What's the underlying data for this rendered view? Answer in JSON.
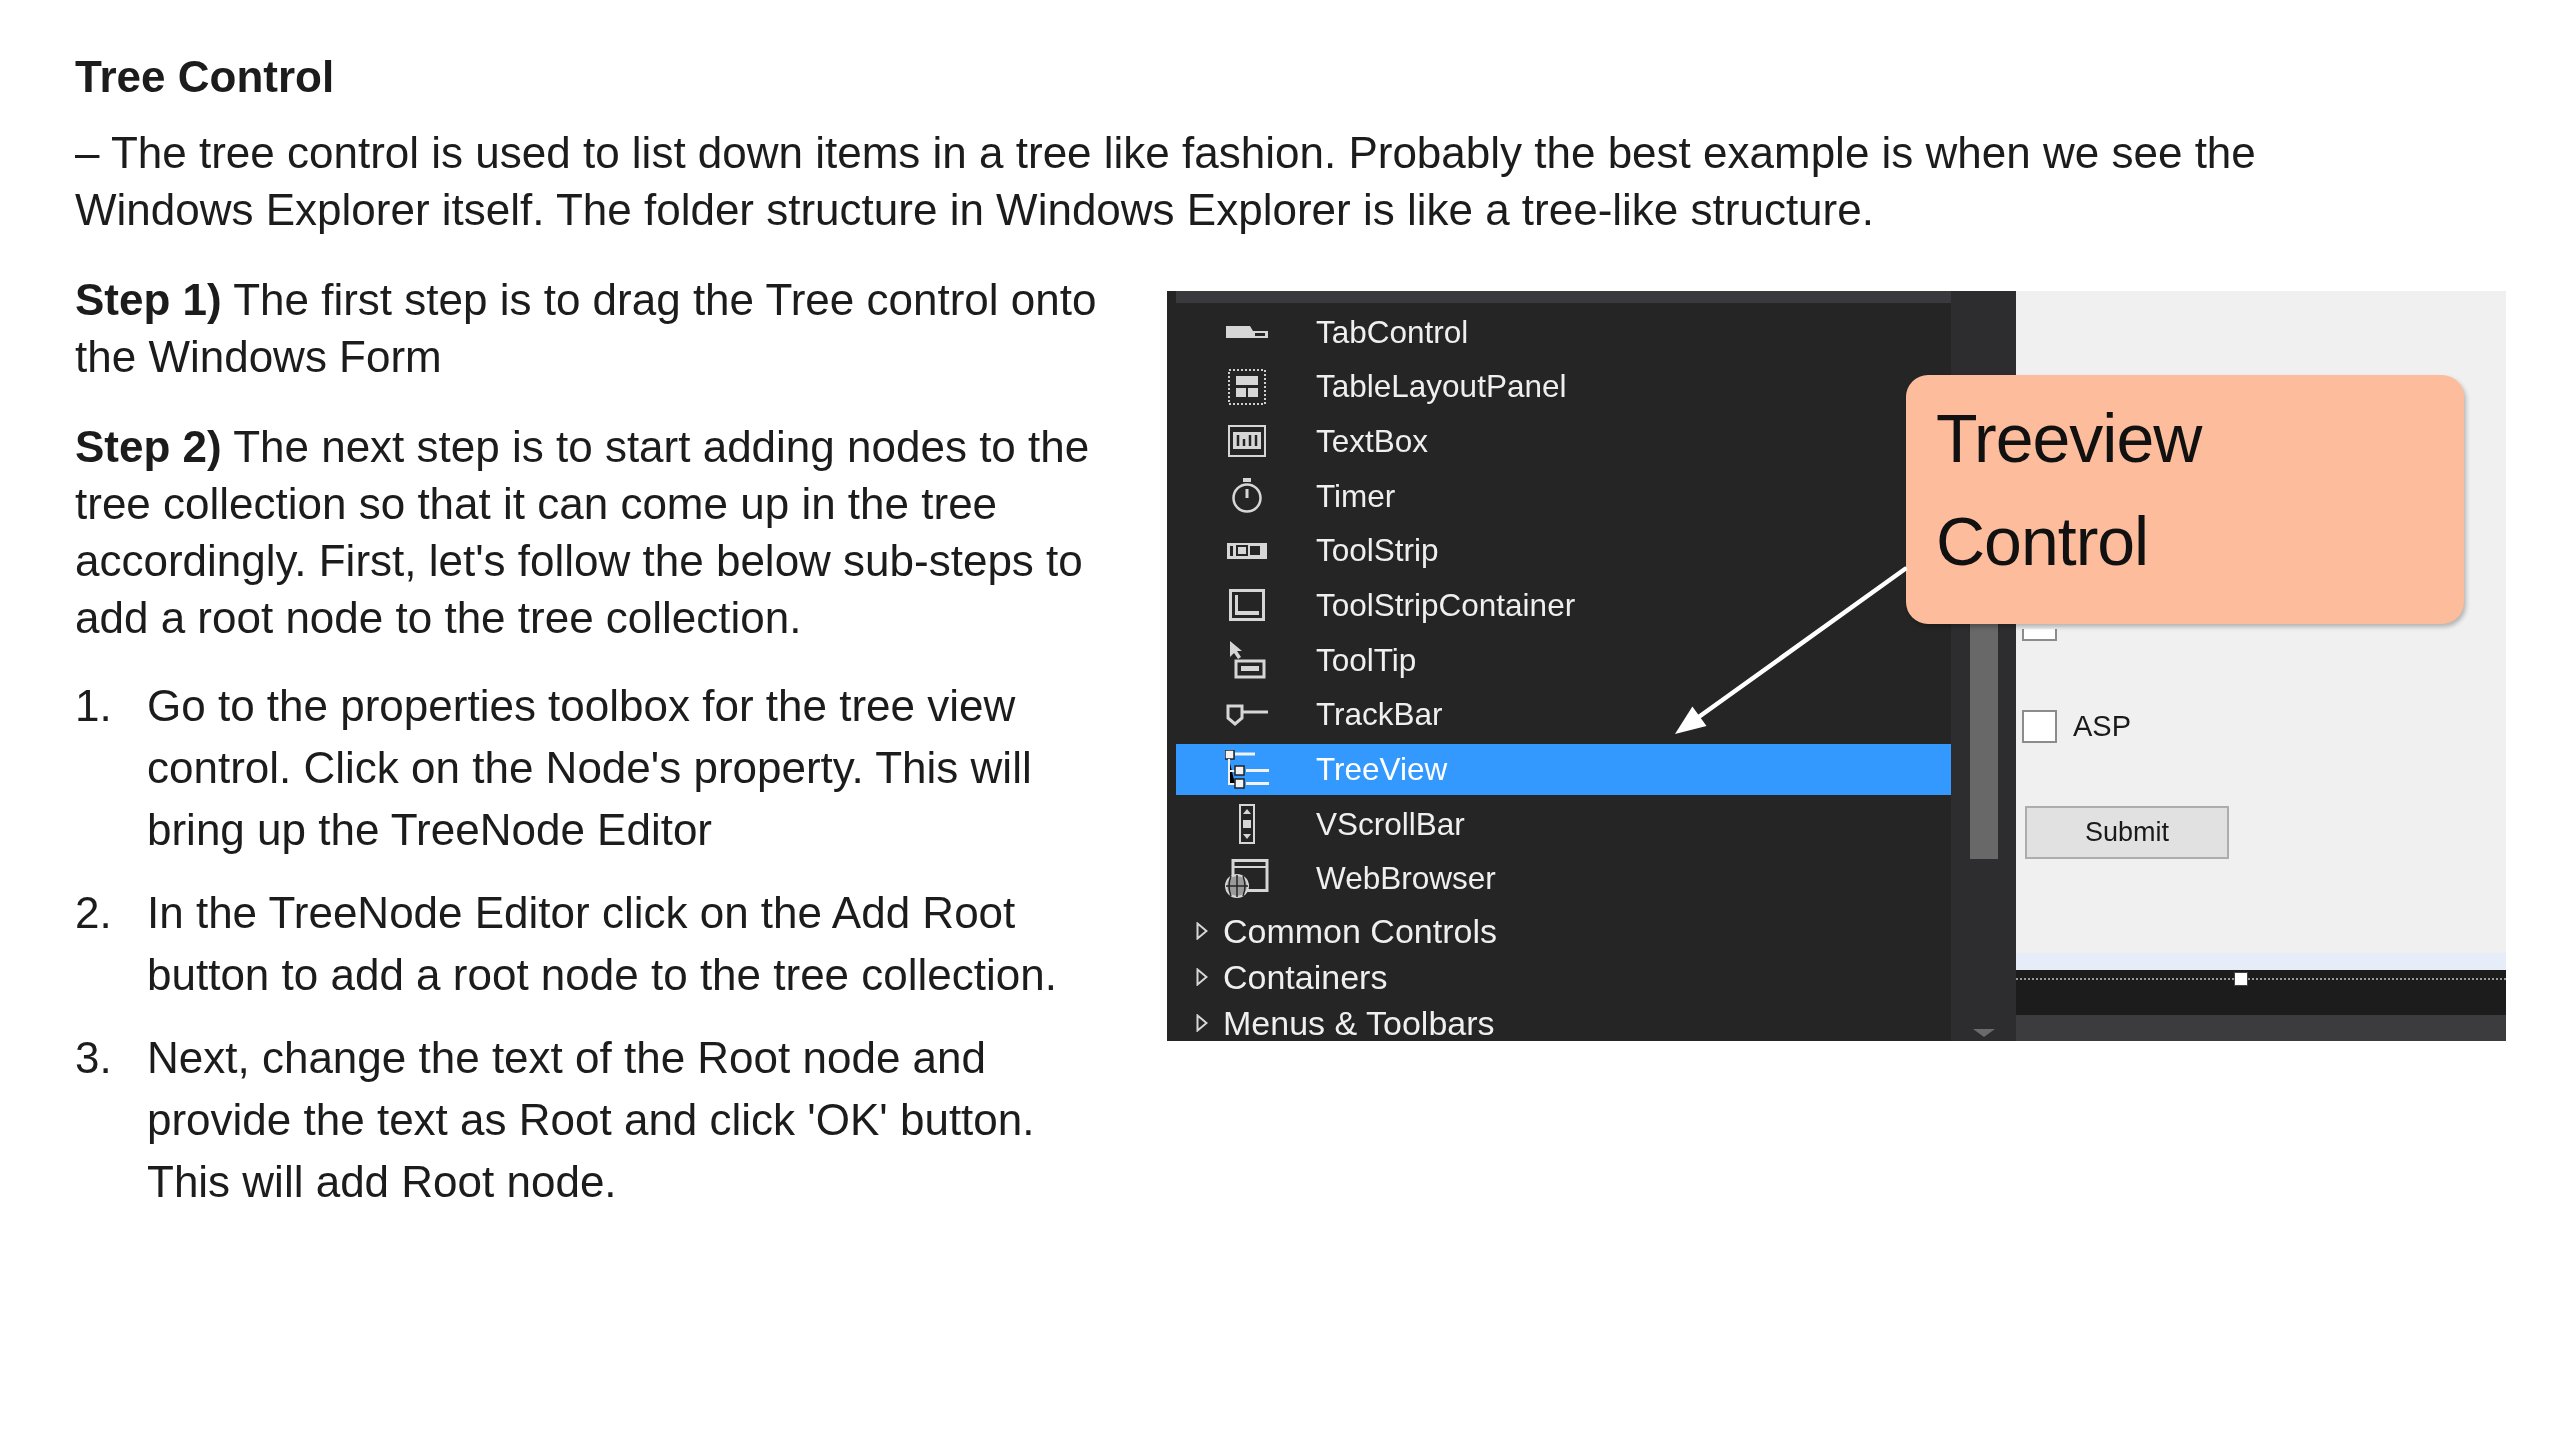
{
  "heading": "Tree Control",
  "intro": "– The tree control is used to list down items in a tree like fashion. Probably the best example is when we see the Windows Explorer itself. The folder structure in Windows Explorer is like a tree-like structure.",
  "steps": [
    "**Step 1)** The first step is to drag the Tree control onto the Windows Form",
    "**Step 2)** The next step is to start adding nodes to the tree collection so that it can come up in the tree accordingly. First, let's follow the below sub-steps to add a root node to the tree collection."
  ],
  "substeps": [
    {
      "number": "1.",
      "text": "Go to the properties toolbox for the tree view control. Click on the Node's property. This will bring up the TreeNode Editor"
    },
    {
      "number": "2.",
      "text": "In the TreeNode Editor click on the Add Root button to add a root node to the tree collection."
    },
    {
      "number": "3.",
      "text": "Next, change the text of the Root node and provide the text as Root and click 'OK' button. This will add Root node."
    }
  ],
  "screenshot": {
    "toolbox": {
      "items": [
        {
          "label": "TabControl",
          "selected": false
        },
        {
          "label": "TableLayoutPanel",
          "selected": false
        },
        {
          "label": "TextBox",
          "selected": false
        },
        {
          "label": "Timer",
          "selected": false
        },
        {
          "label": "ToolStrip",
          "selected": false
        },
        {
          "label": "ToolStripContainer",
          "selected": false
        },
        {
          "label": "ToolTip",
          "selected": false
        },
        {
          "label": "TrackBar",
          "selected": false
        },
        {
          "label": "TreeView",
          "selected": true
        },
        {
          "label": "VScrollBar",
          "selected": false
        },
        {
          "label": "WebBrowser",
          "selected": false
        }
      ],
      "categories": [
        {
          "label": "Common Controls",
          "expanded": false
        },
        {
          "label": "Containers",
          "expanded": false
        },
        {
          "label": "Menus & Toolbars",
          "expanded": false
        }
      ]
    },
    "callout": {
      "lines": [
        "Treeview",
        "Control"
      ]
    },
    "form": {
      "checkboxes": [
        {
          "checked": false
        },
        {
          "label": "ASP",
          "checked": false
        }
      ],
      "button": "Submit"
    }
  }
}
